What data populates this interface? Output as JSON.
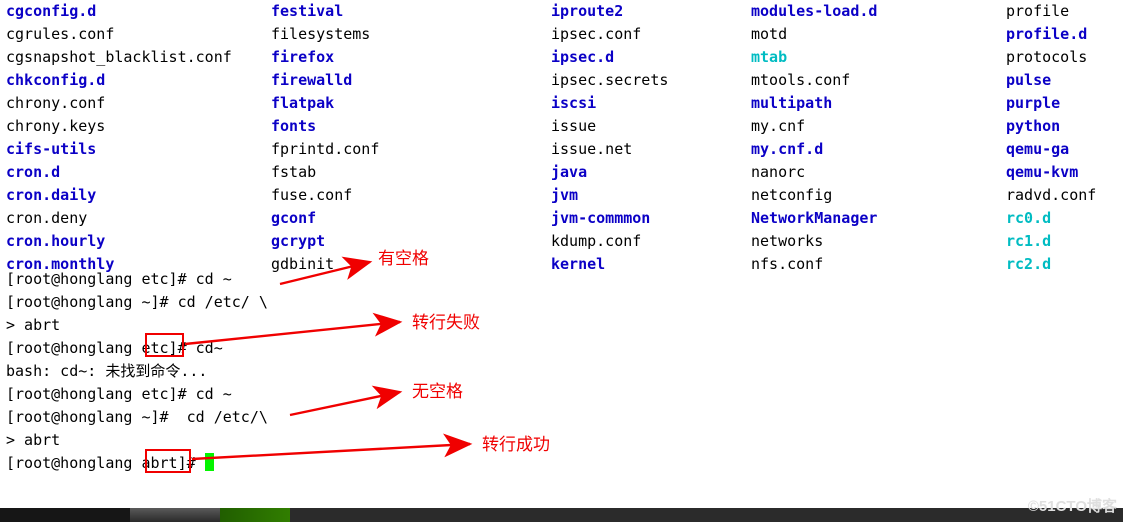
{
  "listing": {
    "columns": [
      [
        {
          "t": "cgconfig.d",
          "c": "dir"
        },
        {
          "t": "cgrules.conf",
          "c": "file"
        },
        {
          "t": "cgsnapshot_blacklist.conf",
          "c": "file"
        },
        {
          "t": "chkconfig.d",
          "c": "dir"
        },
        {
          "t": "chrony.conf",
          "c": "file"
        },
        {
          "t": "chrony.keys",
          "c": "file"
        },
        {
          "t": "cifs-utils",
          "c": "dir"
        },
        {
          "t": "cron.d",
          "c": "dir"
        },
        {
          "t": "cron.daily",
          "c": "dir"
        },
        {
          "t": "cron.deny",
          "c": "file"
        },
        {
          "t": "cron.hourly",
          "c": "dir"
        },
        {
          "t": "cron.monthly",
          "c": "dir"
        }
      ],
      [
        {
          "t": "festival",
          "c": "dir"
        },
        {
          "t": "filesystems",
          "c": "file"
        },
        {
          "t": "firefox",
          "c": "dir"
        },
        {
          "t": "firewalld",
          "c": "dir"
        },
        {
          "t": "flatpak",
          "c": "dir"
        },
        {
          "t": "fonts",
          "c": "dir"
        },
        {
          "t": "fprintd.conf",
          "c": "file"
        },
        {
          "t": "fstab",
          "c": "file"
        },
        {
          "t": "fuse.conf",
          "c": "file"
        },
        {
          "t": "gconf",
          "c": "dir"
        },
        {
          "t": "gcrypt",
          "c": "dir"
        },
        {
          "t": "gdbinit",
          "c": "file"
        }
      ],
      [
        {
          "t": "iproute2",
          "c": "dir"
        },
        {
          "t": "ipsec.conf",
          "c": "file"
        },
        {
          "t": "ipsec.d",
          "c": "dir"
        },
        {
          "t": "ipsec.secrets",
          "c": "file"
        },
        {
          "t": "iscsi",
          "c": "dir"
        },
        {
          "t": "issue",
          "c": "file"
        },
        {
          "t": "issue.net",
          "c": "file"
        },
        {
          "t": "java",
          "c": "dir"
        },
        {
          "t": "jvm",
          "c": "dir"
        },
        {
          "t": "jvm-commmon",
          "c": "dir"
        },
        {
          "t": "kdump.conf",
          "c": "file"
        },
        {
          "t": "kernel",
          "c": "dir"
        }
      ],
      [
        {
          "t": "modules-load.d",
          "c": "dir"
        },
        {
          "t": "motd",
          "c": "file"
        },
        {
          "t": "mtab",
          "c": "link"
        },
        {
          "t": "mtools.conf",
          "c": "file"
        },
        {
          "t": "multipath",
          "c": "dir"
        },
        {
          "t": "my.cnf",
          "c": "file"
        },
        {
          "t": "my.cnf.d",
          "c": "dir"
        },
        {
          "t": "nanorc",
          "c": "file"
        },
        {
          "t": "netconfig",
          "c": "file"
        },
        {
          "t": "NetworkManager",
          "c": "dir"
        },
        {
          "t": "networks",
          "c": "file"
        },
        {
          "t": "nfs.conf",
          "c": "file"
        }
      ],
      [
        {
          "t": "profile",
          "c": "file"
        },
        {
          "t": "profile.d",
          "c": "dir"
        },
        {
          "t": "protocols",
          "c": "file"
        },
        {
          "t": "pulse",
          "c": "dir"
        },
        {
          "t": "purple",
          "c": "dir"
        },
        {
          "t": "python",
          "c": "dir"
        },
        {
          "t": "qemu-ga",
          "c": "dir"
        },
        {
          "t": "qemu-kvm",
          "c": "dir"
        },
        {
          "t": "radvd.conf",
          "c": "file"
        },
        {
          "t": "rc0.d",
          "c": "link"
        },
        {
          "t": "rc1.d",
          "c": "link"
        },
        {
          "t": "rc2.d",
          "c": "link"
        }
      ]
    ]
  },
  "terminal_lines": [
    "[root@honglang etc]# cd ~",
    "[root@honglang ~]# cd /etc/ \\",
    "> abrt",
    "[root@honglang etc]# cd~",
    "bash: cd~: 未找到命令...",
    "[root@honglang etc]# cd ~",
    "[root@honglang ~]#  cd /etc/\\",
    "> abrt",
    "[root@honglang abrt]# "
  ],
  "annotations": {
    "a1": "有空格",
    "a2": "转行失败",
    "a3": "无空格",
    "a4": "转行成功"
  },
  "watermark": "©51CTO博客"
}
